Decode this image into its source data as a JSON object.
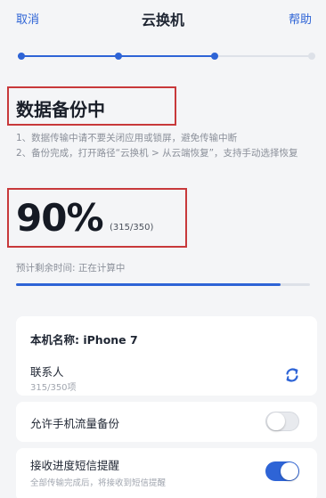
{
  "nav": {
    "cancel_label": "取消",
    "title": "云换机",
    "help_label": "帮助"
  },
  "steps": {
    "total": 4,
    "completed": 3
  },
  "header": {
    "title": "数据备份中",
    "note_line1": "1、数据传输中请不要关闭应用或锁屏，避免传输中断",
    "note_line2": "2、备份完成，打开路径“云换机 > 从云端恢复”，支持手动选择恢复"
  },
  "progress": {
    "percent_text": "90%",
    "count_text": "(315/350)",
    "fraction": 0.9,
    "remaining_text": "预计剩余时间: 正在计算中"
  },
  "device": {
    "name_text": "本机名称: iPhone 7",
    "item_label": "联系人",
    "item_count": "315/350项",
    "item_icon": "sync-icon"
  },
  "settings": {
    "mobile_backup_label": "允许手机流量备份",
    "mobile_backup_on": false,
    "sms_label": "接收进度短信提醒",
    "sms_sub": "全部传输完成后，将接收到短信提醒",
    "sms_on": true
  },
  "colors": {
    "accent": "#2e64d6",
    "highlight_box": "#c8393b"
  }
}
